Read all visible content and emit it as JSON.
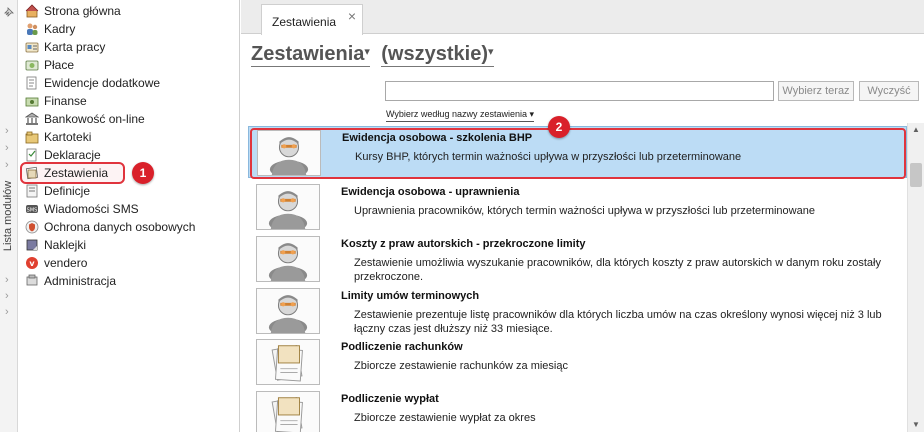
{
  "sidebar": {
    "vertical_label": "Lista modułów",
    "items": [
      {
        "label": "Strona główna",
        "icon": "home-icon"
      },
      {
        "label": "Kadry",
        "icon": "people-icon"
      },
      {
        "label": "Karta pracy",
        "icon": "card-icon"
      },
      {
        "label": "Płace",
        "icon": "payroll-icon"
      },
      {
        "label": "Ewidencje dodatkowe",
        "icon": "records-icon"
      },
      {
        "label": "Finanse",
        "icon": "finance-icon"
      },
      {
        "label": "Bankowość on-line",
        "icon": "bank-icon"
      },
      {
        "label": "Kartoteki",
        "icon": "files-icon"
      },
      {
        "label": "Deklaracje",
        "icon": "declaration-icon"
      },
      {
        "label": "Zestawienia",
        "icon": "report-icon"
      },
      {
        "label": "Definicje",
        "icon": "definitions-icon"
      },
      {
        "label": "Wiadomości SMS",
        "icon": "sms-icon"
      },
      {
        "label": "Ochrona danych osobowych",
        "icon": "shield-icon"
      },
      {
        "label": "Naklejki",
        "icon": "sticker-icon"
      },
      {
        "label": "vendero",
        "icon": "vendero-icon"
      },
      {
        "label": "Administracja",
        "icon": "admin-icon"
      }
    ],
    "selected_index": 9
  },
  "tab": {
    "label": "Zestawienia",
    "close": "×"
  },
  "header": {
    "title": "Zestawienia",
    "scope": "(wszystkie)",
    "caret": "▾"
  },
  "search": {
    "value": "",
    "placeholder": ""
  },
  "buttons": {
    "choose_now": "Wybierz teraz",
    "clear": "Wyczyść"
  },
  "filter": {
    "label": "Wybierz według nazwy zestawienia ▾"
  },
  "badges": {
    "one": "1",
    "two": "2"
  },
  "rows": [
    {
      "name": "Ewidencja osobowa - szkolenia BHP",
      "desc": "Kursy BHP, których termin ważności upływa w przyszłości lub przeterminowane",
      "icon": "person-report-icon"
    },
    {
      "name": "Ewidencja osobowa - uprawnienia",
      "desc": "Uprawnienia pracowników, których termin ważności upływa w przyszłości lub przeterminowane",
      "icon": "person-report-icon"
    },
    {
      "name": "Koszty z praw autorskich - przekroczone limity",
      "desc": "Zestawienie umożliwia wyszukanie pracowników, dla których koszty z praw autorskich w danym roku zostały przekroczone.",
      "icon": "person-report-icon"
    },
    {
      "name": "Limity umów terminowych",
      "desc": "Zestawienie prezentuje listę pracowników dla których liczba umów na czas określony wynosi więcej niż 3 lub łączny czas jest dłuższy niż 33 miesiące.",
      "icon": "person-report-icon"
    },
    {
      "name": "Podliczenie rachunków",
      "desc": "Zbiorcze zestawienie rachunków za miesiąc",
      "icon": "papers-report-icon"
    },
    {
      "name": "Podliczenie wypłat",
      "desc": "Zbiorcze zestawienie wypłat za okres",
      "icon": "papers-report-icon"
    }
  ],
  "colors": {
    "accent_red": "#e0343d",
    "selection_blue": "#bcdcf5"
  }
}
